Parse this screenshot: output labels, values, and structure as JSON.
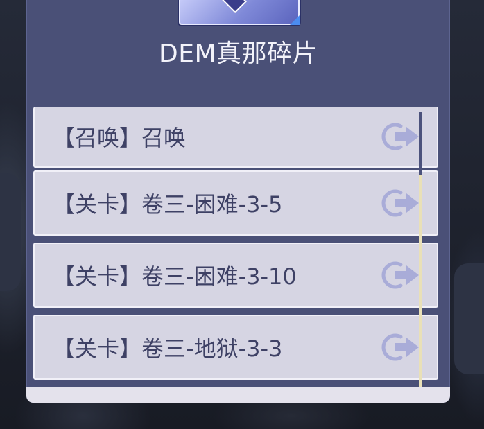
{
  "dialog": {
    "title": "DEM真那碎片",
    "item_icon": "crystal-shard-icon"
  },
  "sources": [
    {
      "type": "【召唤】",
      "name": "召唤"
    },
    {
      "type": "【关卡】",
      "name": "卷三-困难-3-5"
    },
    {
      "type": "【关卡】",
      "name": "卷三-困难-3-10"
    },
    {
      "type": "【关卡】",
      "name": "卷三-地狱-3-3"
    }
  ],
  "colors": {
    "panel": "#4a5077",
    "row": "#d6d5e3",
    "text": "#3e4165",
    "go_icon": "#a9acd8"
  }
}
